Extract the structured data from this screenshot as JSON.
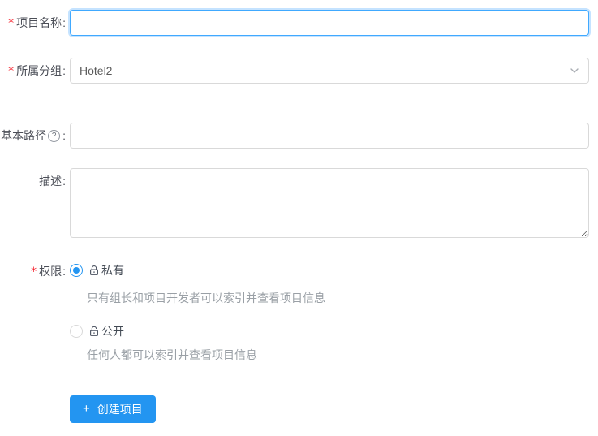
{
  "ui": {
    "colon": ":",
    "required_mark": "*",
    "help_glyph": "?",
    "plus_glyph": "+"
  },
  "form": {
    "project_name": {
      "label": "项目名称",
      "required": true,
      "value": "",
      "focused": true
    },
    "group": {
      "label": "所属分组",
      "required": true,
      "value": "Hotel2"
    },
    "base_path": {
      "label": "基本路径",
      "value": ""
    },
    "description": {
      "label": "描述",
      "value": ""
    },
    "permission": {
      "label": "权限",
      "required": true,
      "private": {
        "label": "私有",
        "selected": true,
        "description": "只有组长和项目开发者可以索引并查看项目信息"
      },
      "public": {
        "label": "公开",
        "selected": false,
        "description": "任何人都可以索引并查看项目信息"
      }
    },
    "submit_label": "创建项目"
  },
  "colors": {
    "accent": "#2395f1",
    "focus_border": "#40a9ff",
    "input_border": "#d9d9d9",
    "required": "#f5222d",
    "label_text": "#4b4e57",
    "muted_text": "#9aa0a6",
    "divider": "#e8e8e8"
  }
}
